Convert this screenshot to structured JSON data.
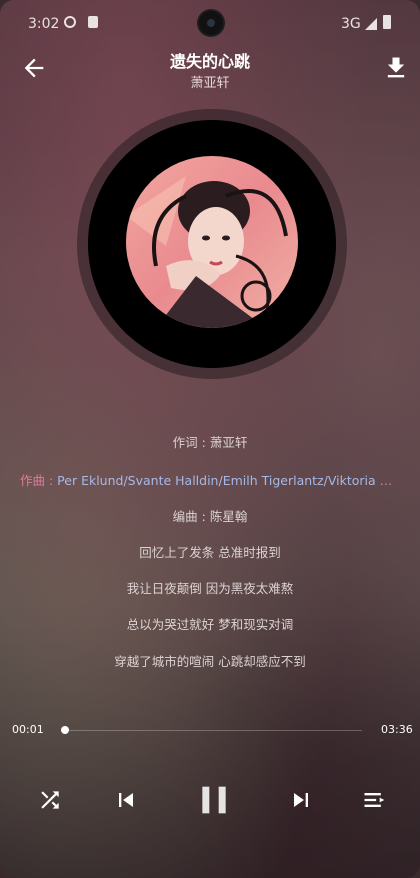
{
  "status": {
    "time": "3:02",
    "network": "3G"
  },
  "song": {
    "title": "遗失的心跳",
    "artist": "萧亚轩"
  },
  "lyrics": {
    "credit_lyricist": "作词 : 萧亚轩",
    "credit_composer_prefix": "作曲 : ",
    "credit_composer_names": "Per Eklund/Svante Halldin/Emilh Tigerlantz/Viktoria Sandstrom",
    "credit_arranger": "编曲 : 陈星翰",
    "lines": [
      "回忆上了发条 总准时报到",
      "我让日夜颠倒 因为黑夜太难熬",
      "总以为哭过就好 梦和现实对调",
      "穿越了城市的喧闹 心跳却感应不到"
    ]
  },
  "playback": {
    "current_time": "00:01",
    "total_time": "03:36",
    "progress": 0.005
  },
  "colors": {
    "active_lyric": "#e07b9e",
    "active_lyric_names": "#a7b8e6"
  },
  "icons": [
    "arrow-left-icon",
    "download-icon",
    "shuffle-icon",
    "skip-previous-icon",
    "pause-icon",
    "skip-next-icon",
    "queue-icon"
  ]
}
